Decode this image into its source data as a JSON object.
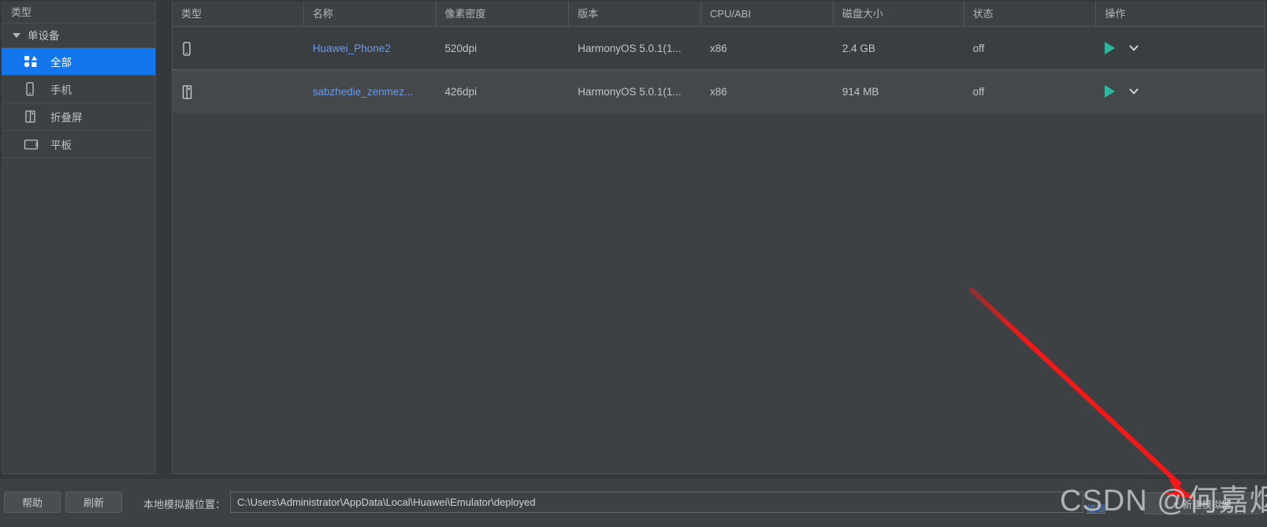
{
  "sidebar": {
    "header": "类型",
    "group_label": "单设备",
    "items": [
      {
        "label": "全部",
        "icon": "all-devices-icon",
        "selected": true
      },
      {
        "label": "手机",
        "icon": "phone-icon",
        "selected": false
      },
      {
        "label": "折叠屏",
        "icon": "foldable-icon",
        "selected": false
      },
      {
        "label": "平板",
        "icon": "tablet-icon",
        "selected": false
      }
    ]
  },
  "table": {
    "columns": [
      "类型",
      "名称",
      "像素密度",
      "版本",
      "CPU/ABI",
      "磁盘大小",
      "状态",
      "操作"
    ],
    "rows": [
      {
        "type_icon": "phone-icon",
        "name": "Huawei_Phone2",
        "density": "520dpi",
        "version": "HarmonyOS 5.0.1(1...",
        "cpu_abi": "x86",
        "disk_size": "2.4 GB",
        "status": "off",
        "play_icon": "play-icon",
        "menu_icon": "chevron-down-icon"
      },
      {
        "type_icon": "foldable-icon",
        "name": "sabzhedie_zenmez...",
        "density": "426dpi",
        "version": "HarmonyOS 5.0.1(1...",
        "cpu_abi": "x86",
        "disk_size": "914 MB",
        "status": "off",
        "play_icon": "play-icon",
        "menu_icon": "chevron-down-icon"
      }
    ]
  },
  "footer": {
    "help_label": "帮助",
    "refresh_label": "刷新",
    "location_label": "本地模拟器位置：",
    "location_value": "C:\\Users\\Administrator\\AppData\\Local\\Huawei\\Emulator\\deployed",
    "location_placeholder": "C:\\Users\\Administrator\\AppData\\Local\\Huawei\\Emulator\\deployed",
    "edit_label": "编辑",
    "new_emulator_label": "新建模拟器",
    "new_emulator_plus": "+"
  },
  "annotation": {
    "watermark": "CSDN @何嘉烟",
    "arrow_color": "#f41818"
  },
  "colors": {
    "accent_selected": "#1276ef",
    "link": "#6b9aec",
    "play_green": "#2fb8a0",
    "panel_bg": "#3d4144",
    "page_bg": "#35383b"
  }
}
